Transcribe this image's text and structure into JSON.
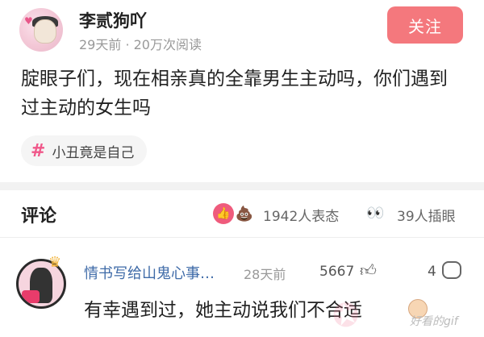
{
  "post": {
    "username": "李贰狗吖",
    "meta": "29天前 · 20万次阅读",
    "follow_label": "关注",
    "body": "腚眼子们，现在相亲真的全靠男生主动吗，你们遇到过主动的女生吗",
    "tag": {
      "icon": "hash-icon",
      "label": "小丑竟是自己"
    }
  },
  "comments_section": {
    "title": "评论",
    "reactions": {
      "icons": [
        "like-icon",
        "poop-icon"
      ],
      "count_text": "1942人表态"
    },
    "inserts": {
      "icon": "eyes-icon",
      "count_text": "39人插眼"
    },
    "items": [
      {
        "name": "情书写给山鬼心事…",
        "time": "28天前",
        "likes": "5667",
        "replies": "4",
        "text": "有幸遇到过，她主动说我们不合适"
      }
    ]
  },
  "watermark": "好看的gif",
  "colors": {
    "accent": "#f4787d",
    "tag_hash": "#f0588a",
    "link_name": "#3f6ba8"
  }
}
